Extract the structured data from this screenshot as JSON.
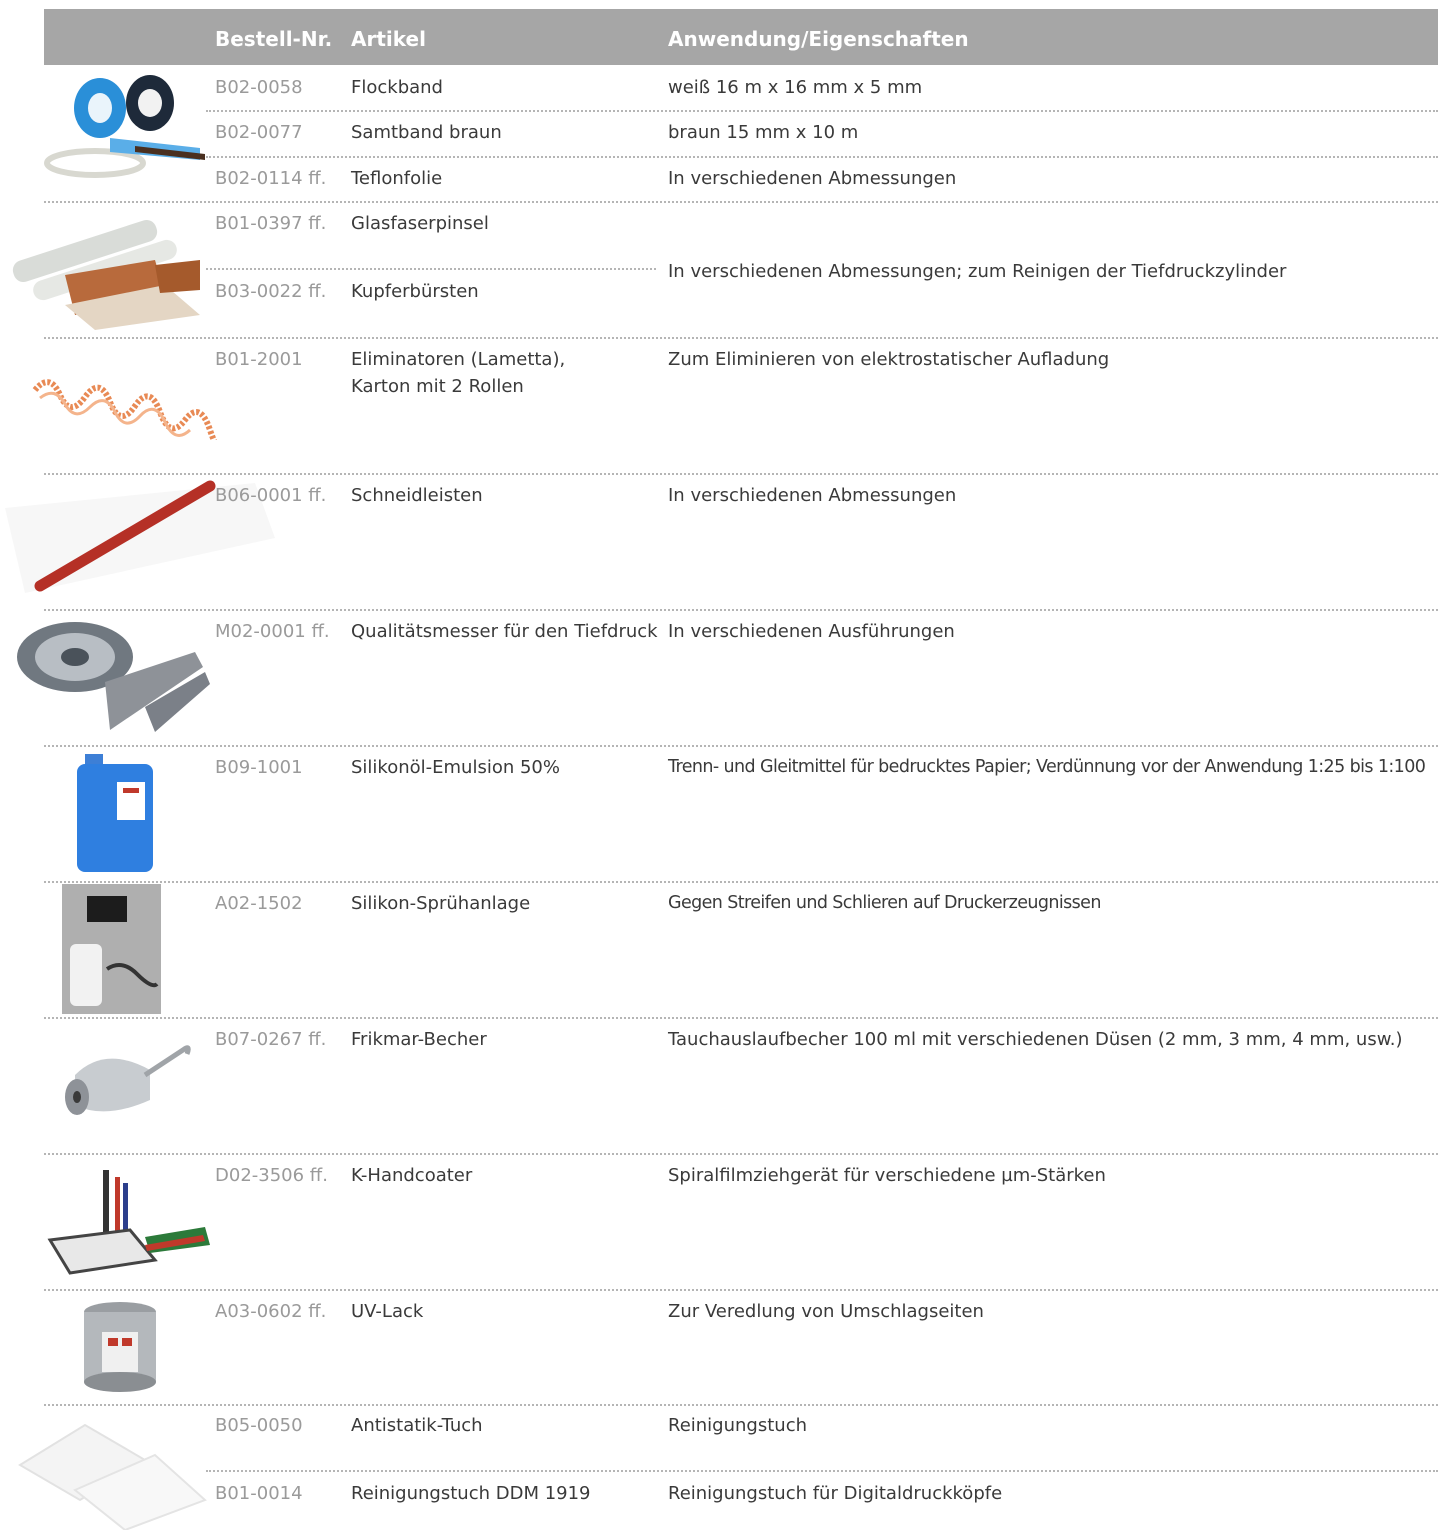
{
  "header": {
    "col_code": "Bestell-Nr.",
    "col_article": "Artikel",
    "col_usage": "Anwendung/Eigenschaften"
  },
  "rows": [
    {
      "code": "B02-0058",
      "article": "Flockband",
      "usage": "weiß 16 m x 16 mm x 5 mm"
    },
    {
      "code": "B02-0077",
      "article": "Samtband braun",
      "usage": "braun 15 mm x 10 m"
    },
    {
      "code": "B02-0114 ff.",
      "article": "Teflonfolie",
      "usage": "In verschiedenen Abmessungen"
    },
    {
      "code": "B01-0397 ff.",
      "article": "Glasfaserpinsel",
      "usage": ""
    },
    {
      "code": "B03-0022 ff.",
      "article": "Kupferbürsten",
      "usage": ""
    },
    {
      "code": "B01-2001",
      "article": "Eliminatoren (Lametta),",
      "article_line2": "Karton mit 2 Rollen",
      "usage": "Zum Eliminieren von elektrostatischer Aufladung"
    },
    {
      "code": "B06-0001 ff.",
      "article": "Schneidleisten",
      "usage": "In verschiedenen Abmessungen"
    },
    {
      "code": "M02-0001 ff.",
      "article": "Qualitätsmesser für den Tiefdruck",
      "usage": "In verschiedenen Ausführungen"
    },
    {
      "code": "B09-1001",
      "article": "Silikonöl-Emulsion 50%",
      "usage": "Trenn- und Gleitmittel für bedrucktes Papier; Verdünnung vor der Anwendung 1:25 bis 1:100"
    },
    {
      "code": "A02-1502",
      "article": "Silikon-Sprühanlage",
      "usage": "Gegen Streifen und Schlieren auf Druckerzeugnissen"
    },
    {
      "code": "B07-0267 ff.",
      "article": "Frikmar-Becher",
      "usage": "Tauchauslaufbecher 100 ml mit verschiedenen Düsen (2 mm, 3 mm, 4 mm, usw.)"
    },
    {
      "code": "D02-3506 ff.",
      "article": "K-Handcoater",
      "usage": "Spiralfilmziehgerät für verschiedene µm-Stärken"
    },
    {
      "code": "A03-0602 ff.",
      "article": "UV-Lack",
      "usage": "Zur Veredlung von Umschlagseiten"
    },
    {
      "code": "B05-0050",
      "article": "Antistatik-Tuch",
      "usage": "Reinigungstuch"
    },
    {
      "code": "B01-0014",
      "article": "Reinigungstuch DDM 1919",
      "usage": "Reinigungstuch für Digitaldruckköpfe"
    }
  ],
  "merged_usage_brushes": "In verschiedenen Abmessungen; zum Reinigen der Tiefdruckzylinder",
  "colors": {
    "header_bg": "#a6a6a6",
    "header_text": "#ffffff",
    "code_text": "#9a9a9a",
    "body_text": "#3a3a3a",
    "separator": "#b5b5b5"
  }
}
